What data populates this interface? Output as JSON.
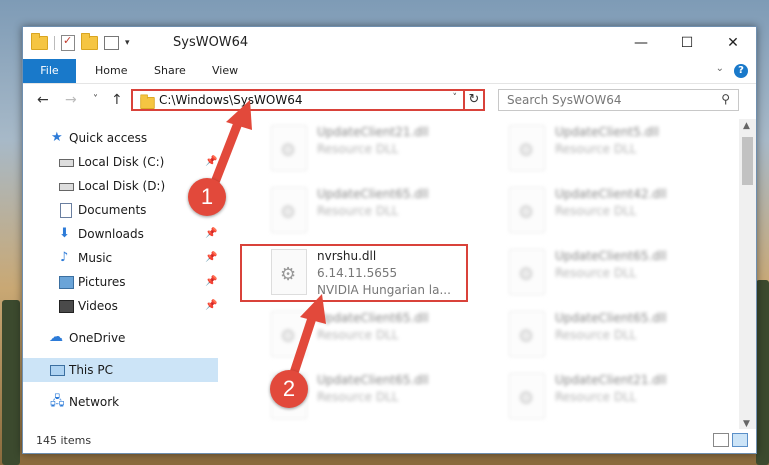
{
  "window": {
    "title": "SysWOW64",
    "minimize_label": "—",
    "maximize_label": "☐",
    "close_label": "✕"
  },
  "ribbon": {
    "tabs": [
      "File",
      "Home",
      "Share",
      "View"
    ],
    "help_label": "?"
  },
  "navigation": {
    "back_label": "←",
    "forward_label": "→",
    "recent_label": "˅",
    "up_label": "↑",
    "address_path": "C:\\Windows\\SysWOW64",
    "refresh_label": "↻",
    "search_placeholder": "Search SysWOW64"
  },
  "sidebar": {
    "items": [
      {
        "label": "Quick access",
        "icon": "star-icon",
        "pinned": false
      },
      {
        "label": "Local Disk (C:)",
        "icon": "disk-icon",
        "pinned": true
      },
      {
        "label": "Local Disk (D:)",
        "icon": "disk-icon",
        "pinned": false
      },
      {
        "label": "Documents",
        "icon": "documents-icon",
        "pinned": true
      },
      {
        "label": "Downloads",
        "icon": "downloads-icon",
        "pinned": true
      },
      {
        "label": "Music",
        "icon": "music-icon",
        "pinned": true
      },
      {
        "label": "Pictures",
        "icon": "pictures-icon",
        "pinned": true
      },
      {
        "label": "Videos",
        "icon": "videos-icon",
        "pinned": true
      },
      {
        "label": "OneDrive",
        "icon": "cloud-icon",
        "pinned": false
      },
      {
        "label": "This PC",
        "icon": "computer-icon",
        "pinned": false,
        "selected": true
      },
      {
        "label": "Network",
        "icon": "network-icon",
        "pinned": false
      }
    ]
  },
  "files": [
    {
      "name": "UpdateClient21.dll",
      "type": "Resource DLL",
      "blurred": true
    },
    {
      "name": "UpdateClient5.dll",
      "type": "Resource DLL",
      "blurred": true
    },
    {
      "name": "UpdateClient65.dll",
      "type": "Resource DLL",
      "blurred": true
    },
    {
      "name": "UpdateClient42.dll",
      "type": "Resource DLL",
      "blurred": true
    },
    {
      "name": "nvrshu.dll",
      "version": "6.14.11.5655",
      "description": "NVIDIA Hungarian la...",
      "blurred": false,
      "highlighted": true
    },
    {
      "name": "UpdateClient65.dll",
      "type": "Resource DLL",
      "blurred": true
    },
    {
      "name": "UpdateClient65.dll",
      "type": "Resource DLL",
      "blurred": true
    },
    {
      "name": "UpdateClient65.dll",
      "type": "Resource DLL",
      "blurred": true
    },
    {
      "name": "UpdateClient65.dll",
      "type": "Resource DLL",
      "blurred": true
    },
    {
      "name": "UpdateClient21.dll",
      "type": "Resource DLL",
      "blurred": true
    }
  ],
  "status": {
    "item_count": "145 items"
  },
  "annotations": {
    "step1": "1",
    "step2": "2",
    "color": "#e2493b"
  }
}
